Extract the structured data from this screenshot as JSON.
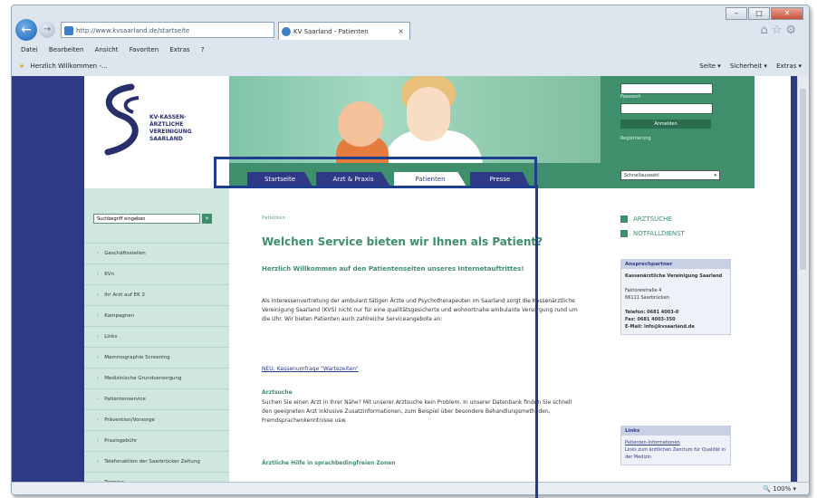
{
  "browser": {
    "address": "http://www.kvsaarland.de/startseite",
    "tab_title": "KV Saarland - Patienten",
    "menu": [
      "Datei",
      "Bearbeiten",
      "Ansicht",
      "Favoriten",
      "Extras",
      "?"
    ],
    "favorite": "Herzlich Willkommen -...",
    "tools": [
      "Seite ▾",
      "Sicherheit ▾",
      "Extras ▾"
    ],
    "zoom": "100%"
  },
  "site": {
    "logo_text": "KV-KASSEN-ÄRZTLICHE VEREINIGUNG SAARLAND",
    "login": {
      "user_label": "Benutzername",
      "pass_label": "Passwort",
      "button": "Anmelden",
      "register": "Registrierung"
    },
    "nav_tabs": [
      "Startseite",
      "Arzt & Praxis",
      "Patienten",
      "Presse"
    ],
    "active_tab": "Patienten",
    "select_placeholder": "Schnellauswahl",
    "search_placeholder": "Suchbegriff eingeben",
    "sidebar_items": [
      "Geschäftsstellen",
      "KVn",
      "Ihr Arzt auf EK 2",
      "Kampagnen",
      "Links",
      "Mammographie Screening",
      "Medizinische Grundversorgung",
      "Patientenservice",
      "Prävention/Vorsorge",
      "Praxisgebühr",
      "Telefonaktion der Saarbrücker Zeitung",
      "Termine"
    ],
    "breadcrumb": "Patienten",
    "heading": "Welchen Service bieten wir Ihnen als Patient?",
    "subheading": "Herzlich Willkommen auf den Patientenseiten unseres Internetauftrittes!",
    "intro": "Als Interessenvertretung der ambulant tätigen Ärzte und Psychotherapeuten im Saarland sorgt die Kassenärztliche Vereinigung Saarland (KVS) nicht nur für eine qualitätsgesicherte und wohnortnahe ambulante Versorgung rund um die Uhr. Wir bieten Patienten auch zahlreiche Serviceangebote an:",
    "link_text": "NEU: Kassenumfrage \"Wartezeiten\"",
    "section1_title": "Arztsuche",
    "section1_text": "Suchen Sie einen Arzt in Ihrer Nähe? Mit unserer Arztsuche kein Problem. In unserer Datenbank finden Sie schnell den geeigneten Arzt inklusive Zusatzinformationen, zum Beispiel über besondere Behandlungsmethoden, Fremdsprachenkenntnisse usw.",
    "section2_title": "Ärztliche Hilfe in sprachbedingfreien Zonen",
    "right_links": [
      "ARZTSUCHE",
      "NOTFALLDIENST"
    ],
    "contact_box": {
      "title": "Ansprechpartner",
      "org": "Kassenärztliche Vereinigung Saarland",
      "street": "Faktoreistraße 4",
      "city": "66111 Saarbrücken",
      "phone": "Telefon: 0681 4003-0",
      "fax": "Fax: 0681 4003-350",
      "email": "E-Mail: info@kvsaarland.de"
    },
    "links_box": {
      "title": "Links",
      "item1": "Patienten-Informationen",
      "item2": "Links zum ärztlichen Zentrum für Qualität in der Medizin"
    }
  },
  "colors": {
    "brand_green": "#3f8f6c",
    "brand_blue": "#2f3a86",
    "highlight": "#1f3d8e"
  }
}
